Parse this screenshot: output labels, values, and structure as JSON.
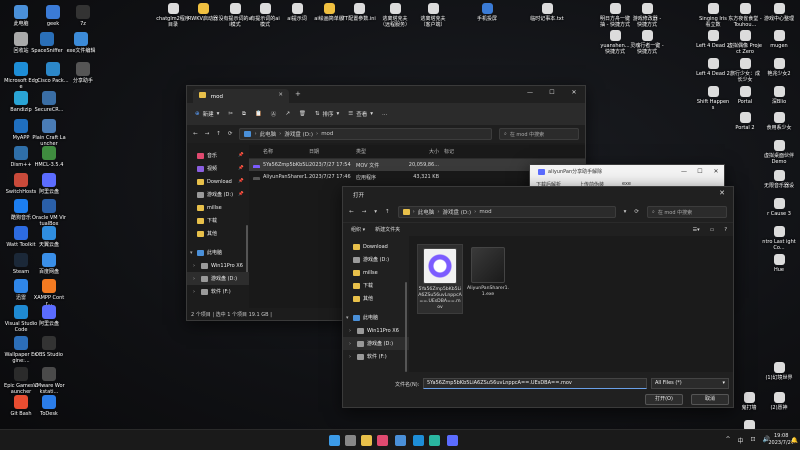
{
  "desktop": {
    "icons": [
      {
        "label": "此电脑",
        "color": "#4a90d9"
      },
      {
        "label": "geek",
        "color": "#3b7bd6"
      },
      {
        "label": "7z",
        "color": "#333333"
      },
      {
        "label": "回收站",
        "color": "#aaaaaa"
      },
      {
        "label": "SpaceSniffer",
        "color": "#2a6fb8"
      },
      {
        "label": "exe文件编辑",
        "color": "#3c8bd8"
      },
      {
        "label": "Microsoft Edge",
        "color": "#1e8ed7"
      },
      {
        "label": "Cisco Pack...",
        "color": "#2c88c9"
      },
      {
        "label": "分享助手",
        "color": "#555555"
      },
      {
        "label": "Bandizip",
        "color": "#2aa5d6"
      },
      {
        "label": "SecureCR...",
        "color": "#3a6ea5"
      },
      {
        "label": "MyAPP",
        "color": "#1f6fbf"
      },
      {
        "label": "Plain Craft Launcher",
        "color": "#4a7cb5"
      },
      {
        "label": "Dism++",
        "color": "#2f6fa8"
      },
      {
        "label": "HMCL-3.5.4",
        "color": "#3f8c3f"
      },
      {
        "label": "SwitchHosts",
        "color": "#c94a3a"
      },
      {
        "label": "阿里云盘",
        "color": "#5b6cff"
      },
      {
        "label": "酷狗音乐",
        "color": "#1c7ef0"
      },
      {
        "label": "Oracle VM VirtualBox",
        "color": "#2a5fa8"
      },
      {
        "label": "Watt Toolkit",
        "color": "#2d6be0"
      },
      {
        "label": "天翼云盘",
        "color": "#2f8ee0"
      },
      {
        "label": "Steam",
        "color": "#1b2838"
      },
      {
        "label": "百度网盘",
        "color": "#3a8fe8"
      },
      {
        "label": "迅雷",
        "color": "#2f86e8"
      },
      {
        "label": "XAMPP Contr...",
        "color": "#f37a21"
      },
      {
        "label": "Visual Studio Code",
        "color": "#1f8ad2"
      },
      {
        "label": "阿里云盘",
        "color": "#5b6cff"
      },
      {
        "label": "Wallpaper Engine:...",
        "color": "#2c6eb8"
      },
      {
        "label": "OBS Studio",
        "color": "#333333"
      },
      {
        "label": "Epic Games Launcher",
        "color": "#2b2b2b"
      },
      {
        "label": "VMware Workstati...",
        "color": "#4a4a4a"
      },
      {
        "label": "Git Bash",
        "color": "#e84d31"
      },
      {
        "label": "ToDesk",
        "color": "#2b7de9"
      }
    ],
    "top_icons": [
      {
        "label": "chatglm2程序目录",
        "color": "#dcdcdc"
      },
      {
        "label": "RWKV启动器",
        "color": "#f0c040"
      },
      {
        "label": "没有提示词的ai模式",
        "color": "#dcdcdc"
      },
      {
        "label": "有提示词的ai模式",
        "color": "#dcdcdc"
      },
      {
        "label": "ai提示词",
        "color": "#dcdcdc"
      },
      {
        "label": "ai绘画简单版",
        "color": "#f0c040"
      },
      {
        "label": "TT配置参数.ini",
        "color": "#dcdcdc"
      },
      {
        "label": "逃离塔克夫（远程服务）",
        "color": "#dcdcdc"
      },
      {
        "label": "逃离塔克夫（客户端）",
        "color": "#dcdcdc"
      },
      {
        "label": "手机投屏",
        "color": "#3a7bd6"
      },
      {
        "label": "临时记事本.txt",
        "color": "#dcdcdc"
      },
      {
        "label": "明日方舟一键抽 - 快捷方式",
        "color": "#dcdcdc"
      },
      {
        "label": "游戏修改器 - 快捷方式",
        "color": "#dcdcdc"
      },
      {
        "label": "yuanshen...快捷方式",
        "color": "#dcdcdc"
      },
      {
        "label": "灵魂行者一键 - 快捷方式",
        "color": "#dcdcdc"
      }
    ],
    "right_icons": [
      {
        "label": "Singing Iris 看立数",
        "color": "#dcdcdc"
      },
      {
        "label": "东方夜雀食堂 - Touhou...",
        "color": "#dcdcdc"
      },
      {
        "label": "游戏中心整理",
        "color": "#dcdcdc"
      },
      {
        "label": "Left 4 Dead 2",
        "color": "#dcdcdc"
      },
      {
        "label": "虚拟偶像 Project Zero",
        "color": "#dcdcdc"
      },
      {
        "label": "mugen",
        "color": "#dcdcdc"
      },
      {
        "label": "Left 4 Dead 2",
        "color": "#dcdcdc"
      },
      {
        "label": "旅行少女：成长少女",
        "color": "#dcdcdc"
      },
      {
        "label": "艳兆少女2",
        "color": "#dcdcdc"
      },
      {
        "label": "Shift Happens",
        "color": "#dcdcdc"
      },
      {
        "label": "Portal",
        "color": "#dcdcdc"
      },
      {
        "label": "深Blio",
        "color": "#dcdcdc"
      },
      {
        "label": "Portal 2",
        "color": "#dcdcdc"
      },
      {
        "label": "食用系少女",
        "color": "#dcdcdc"
      },
      {
        "label": "虚拟桌面伙伴 Demo",
        "color": "#dcdcdc"
      },
      {
        "label": "无限音乐器设",
        "color": "#dcdcdc"
      },
      {
        "label": "r Cause 3",
        "color": "#dcdcdc"
      },
      {
        "label": "ntro Last ight Co...",
        "color": "#dcdcdc"
      },
      {
        "label": "Hue",
        "color": "#dcdcdc"
      },
      {
        "label": "(1)幻境世界",
        "color": "#dcdcdc"
      },
      {
        "label": "鬼打墙",
        "color": "#dcdcdc"
      },
      {
        "label": "(2)愿神",
        "color": "#dcdcdc"
      },
      {
        "label": "吴牛地下城",
        "color": "#dcdcdc"
      }
    ]
  },
  "explorer": {
    "tab_title": "mod",
    "toolbar": {
      "new_label": "新建",
      "sort_label": "排序",
      "view_label": "查看",
      "more_label": "..."
    },
    "breadcrumb": [
      "此电脑",
      "游戏盘 (D:)",
      "mod"
    ],
    "search_placeholder": "在 mod 中搜索",
    "nav": [
      {
        "label": "音乐",
        "icon": "music-icon",
        "color": "#e04a70",
        "pinned": true
      },
      {
        "label": "视频",
        "icon": "video-icon",
        "color": "#8b5fe0",
        "pinned": true
      },
      {
        "label": "Download",
        "icon": "folder-icon",
        "color": "#e8c04a",
        "pinned": true
      },
      {
        "label": "游戏盘 (D:)",
        "icon": "drive-icon",
        "color": "#9a9a9a",
        "pinned": true
      },
      {
        "label": "millse",
        "icon": "folder-icon",
        "color": "#e8c04a",
        "pinned": false
      },
      {
        "label": "下载",
        "icon": "folder-icon",
        "color": "#e8c04a",
        "pinned": false
      },
      {
        "label": "其他",
        "icon": "folder-icon",
        "color": "#e8c04a",
        "pinned": false
      },
      {
        "label": "此电脑",
        "icon": "pc-icon",
        "color": "#4a90d9",
        "pinned": false
      },
      {
        "label": "Win11Pro X6",
        "icon": "drive-icon",
        "color": "#9a9a9a",
        "pinned": false
      },
      {
        "label": "游戏盘 (D:)",
        "icon": "drive-icon",
        "color": "#9a9a9a",
        "pinned": false
      },
      {
        "label": "软件 (F:)",
        "icon": "drive-icon",
        "color": "#9a9a9a",
        "pinned": false
      }
    ],
    "columns": [
      "名称",
      "日期",
      "类型",
      "大小",
      "标记"
    ],
    "files": [
      {
        "name": "5Ya56Zmp5bKb5LiA6ZSu56uvLnBwcA==.UEsDBA==.mov",
        "date": "2023/7/27 17:54",
        "type": "MOV 文件",
        "size": "20,059,86...",
        "tag": "",
        "color": "#7c5cff"
      },
      {
        "name": "AliyunPanSharer1.1.exe",
        "date": "2023/7/27 17:46",
        "type": "应用程序",
        "size": "43,321 KB",
        "tag": "",
        "color": "#555555"
      }
    ],
    "status": "2 个项目 | 选中 1 个项目 19.1 GB |"
  },
  "small_window": {
    "title": "aliyunPan分享助手解除",
    "row1_a": "下载后解析",
    "row1_b": "上传前伪装",
    "row1_c": "exe"
  },
  "open_dialog": {
    "title": "打开",
    "breadcrumb": [
      "此电脑",
      "游戏盘 (D:)",
      "mod"
    ],
    "search_placeholder": "在 mod 中搜索",
    "organize_label": "组织 ▾",
    "newfolder_label": "新建文件夹",
    "nav": [
      {
        "label": "Download",
        "icon": "folder-icon",
        "color": "#e8c04a"
      },
      {
        "label": "游戏盘 (D:)",
        "icon": "drive-icon",
        "color": "#9a9a9a"
      },
      {
        "label": "millse",
        "icon": "folder-icon",
        "color": "#e8c04a"
      },
      {
        "label": "下载",
        "icon": "folder-icon",
        "color": "#e8c04a"
      },
      {
        "label": "其他",
        "icon": "folder-icon",
        "color": "#e8c04a"
      },
      {
        "label": "此电脑",
        "icon": "pc-icon",
        "color": "#4a90d9"
      },
      {
        "label": "Win11Pro X6",
        "icon": "drive-icon",
        "color": "#9a9a9a"
      },
      {
        "label": "游戏盘 (D:)",
        "icon": "drive-icon",
        "color": "#9a9a9a"
      },
      {
        "label": "软件 (F:)",
        "icon": "drive-icon",
        "color": "#9a9a9a"
      }
    ],
    "tiles": [
      {
        "label": "5Ya56Zmp5bKb5LiA6ZSu56uvLnppcA==.UEsDBA==.mov",
        "color": "#7c5cff"
      },
      {
        "label": "AliyunPanSharer1.1.exe",
        "color": "#2a2a2a"
      }
    ],
    "filename_label": "文件名(N):",
    "filename_value": "5Ya56Zmp5bKb5LiA6ZSu56uvLnppcA==.UEsDBA==.mov",
    "filter_value": "All Files (*)",
    "open_label": "打开(O)",
    "cancel_label": "取消"
  },
  "taskbar": {
    "icons": [
      {
        "name": "start-icon",
        "color": "#3c9be8"
      },
      {
        "name": "taskview-icon",
        "color": "#888888"
      },
      {
        "name": "explorer-icon",
        "color": "#e8c04a"
      },
      {
        "name": "store-icon",
        "color": "#e04a70"
      },
      {
        "name": "mail-icon",
        "color": "#4a90d9"
      },
      {
        "name": "browser-icon",
        "color": "#1e8ed7"
      },
      {
        "name": "edge-icon",
        "color": "#2ab6a0"
      },
      {
        "name": "aliyunpan-icon",
        "color": "#5b6cff"
      }
    ],
    "tray": [
      "^",
      "中",
      "⊡",
      "🔊"
    ],
    "time": "19:08",
    "date": "2023/7/27"
  }
}
